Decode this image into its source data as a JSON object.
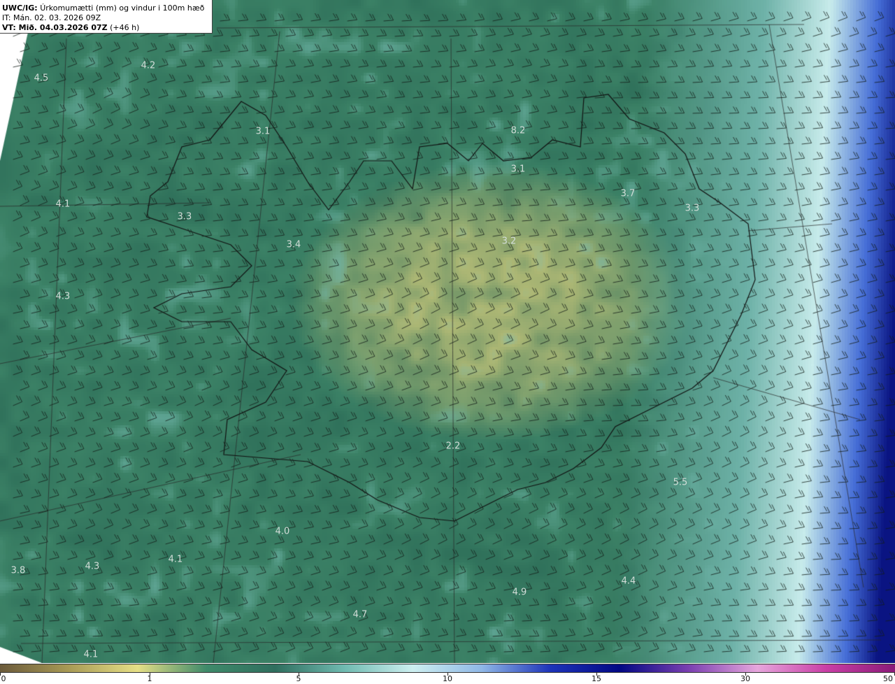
{
  "header": {
    "prefix": "UWC/IG:",
    "title": "Úrkomumætti (mm) og vindur i 100m hæð",
    "it_line": "IT: Mán. 02. 03. 2026 09Z",
    "vt_prefix": "VT: Mið. 04.03.2026 07Z",
    "vt_suffix": "(+46 h)"
  },
  "field_labels": [
    "4.5",
    "4.2",
    "3.1",
    "8.2",
    "3.1",
    "4.1",
    "3.3",
    "3.4",
    "3.2",
    "3.7",
    "3.3",
    "4.3",
    "2.2",
    "5.5",
    "4.0",
    "4.1",
    "3.8",
    "4.3",
    "4.4",
    "4.9",
    "4.7",
    "4.1"
  ],
  "colorbar": {
    "ticks": [
      "0",
      "1",
      "5",
      "10",
      "15",
      "30",
      "50"
    ],
    "colors": [
      "#6b5a3a",
      "#a89a55",
      "#e6df86",
      "#3f8a6a",
      "#2f6e5e",
      "#6fbab0",
      "#cdeff0",
      "#8fb7e6",
      "#1d33b8",
      "#020883",
      "#7a3fb0",
      "#e6a6dc",
      "#c93fa6",
      "#8a1a78"
    ]
  },
  "wind_legend": {
    "unit_note": ""
  }
}
